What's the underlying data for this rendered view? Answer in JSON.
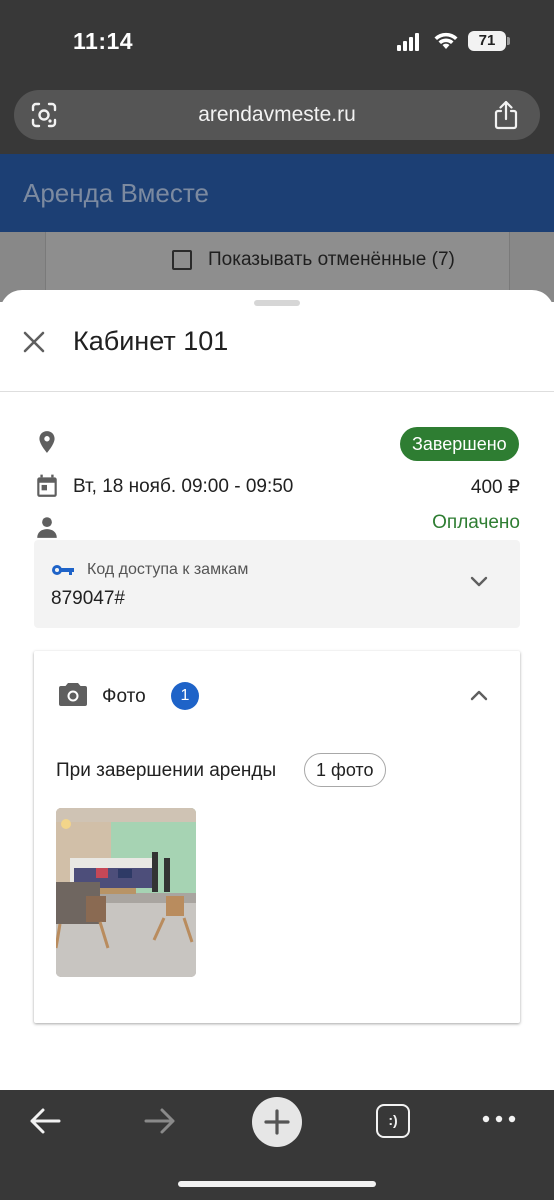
{
  "status_bar": {
    "time": "11:14",
    "battery_level": "71",
    "icons": [
      "signal-icon",
      "wifi-icon",
      "battery-icon"
    ]
  },
  "browser": {
    "url": "arendavmeste.ru",
    "icons": [
      "lens-icon",
      "share-icon"
    ]
  },
  "app": {
    "title": "Аренда Вместе",
    "show_cancelled_label": "Показывать отменённые (7)",
    "show_cancelled_checked": false
  },
  "sheet": {
    "title": "Кабинет 101",
    "status": "Завершено",
    "date_time": "Вт, 18 нояб. 09:00 - 09:50",
    "price": "400 ₽",
    "payment_status": "Оплачено",
    "lock": {
      "label": "Код доступа к замкам",
      "code": "879047#"
    },
    "photos": {
      "label": "Фото",
      "count": "1",
      "completion_label": "При завершении аренды",
      "completion_count": "1 фото"
    }
  },
  "colors": {
    "header_blue": "#1c3f74",
    "status_green": "#2e7d32",
    "badge_blue": "#1e63c8",
    "key_blue": "#1e63c8",
    "chrome_dark": "#383838"
  },
  "toolbar": {
    "icons": [
      "back-arrow-icon",
      "forward-arrow-icon",
      "new-tab-plus-icon",
      "tabs-counter-icon",
      "more-icon"
    ],
    "tabs_label": ":)"
  }
}
